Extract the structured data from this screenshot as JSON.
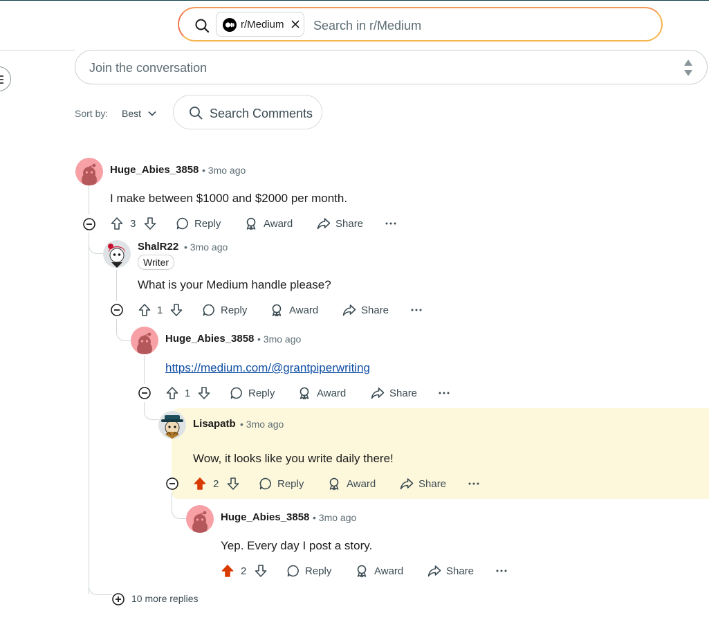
{
  "search": {
    "subreddit_chip": "r/Medium",
    "placeholder": "Search in r/Medium"
  },
  "composer": {
    "placeholder": "Join the conversation"
  },
  "sort": {
    "label": "Sort by:",
    "value": "Best"
  },
  "search_comments": {
    "label": "Search Comments"
  },
  "actions": {
    "reply": "Reply",
    "award": "Award",
    "share": "Share"
  },
  "colors": {
    "upvoted": "#d93a00",
    "highlight": "#fdf7db",
    "link": "#0e4ea3"
  },
  "comments": [
    {
      "author": "Huge_Abies_3858",
      "time": "• 3mo ago",
      "text": "I make between $1000 and $2000 per month.",
      "score": "3",
      "upvoted": false
    },
    {
      "author": "ShalR22",
      "flair": "Writer",
      "time": "• 3mo ago",
      "text": "What is your Medium handle please?",
      "score": "1",
      "upvoted": false
    },
    {
      "author": "Huge_Abies_3858",
      "time": "• 3mo ago",
      "text": "https://medium.com/@grantpiperwriting",
      "score": "1",
      "upvoted": false
    },
    {
      "author": "Lisapatb",
      "time": "• 3mo ago",
      "text": "Wow, it looks like you write daily there!",
      "score": "2",
      "upvoted": true,
      "highlighted": true
    },
    {
      "author": "Huge_Abies_3858",
      "time": "• 3mo ago",
      "text": "Yep. Every day I post a story.",
      "score": "2",
      "upvoted": true
    }
  ],
  "more_replies": "10 more replies"
}
